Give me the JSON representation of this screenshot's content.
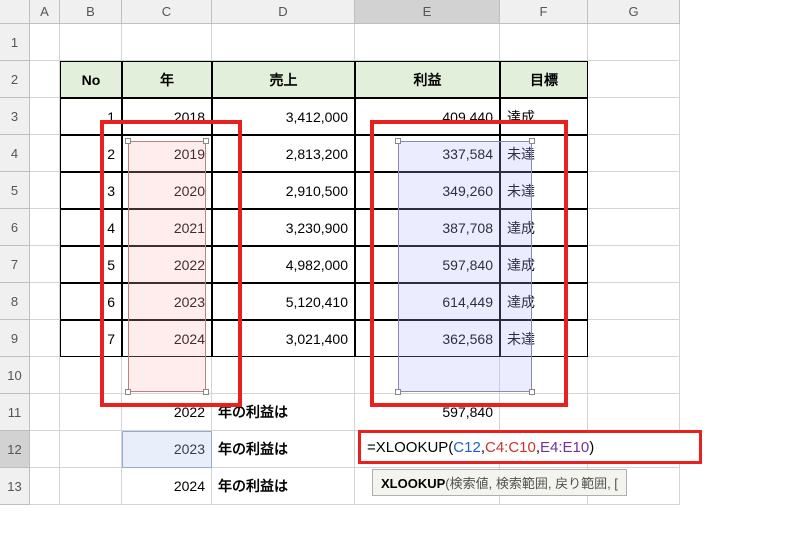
{
  "columns": [
    "A",
    "B",
    "C",
    "D",
    "E",
    "F",
    "G"
  ],
  "headers": {
    "no": "No",
    "year": "年",
    "sales": "売上",
    "profit": "利益",
    "target": "目標"
  },
  "rows": [
    {
      "no": 1,
      "year": 2018,
      "sales": "3,412,000",
      "profit": "409,440",
      "target": "達成"
    },
    {
      "no": 2,
      "year": 2019,
      "sales": "2,813,200",
      "profit": "337,584",
      "target": "未達"
    },
    {
      "no": 3,
      "year": 2020,
      "sales": "2,910,500",
      "profit": "349,260",
      "target": "未達"
    },
    {
      "no": 4,
      "year": 2021,
      "sales": "3,230,900",
      "profit": "387,708",
      "target": "達成"
    },
    {
      "no": 5,
      "year": 2022,
      "sales": "4,982,000",
      "profit": "597,840",
      "target": "達成"
    },
    {
      "no": 6,
      "year": 2023,
      "sales": "5,120,410",
      "profit": "614,449",
      "target": "達成"
    },
    {
      "no": 7,
      "year": 2024,
      "sales": "3,021,400",
      "profit": "362,568",
      "target": "未達"
    }
  ],
  "lookup_rows": [
    {
      "year": 2022,
      "label": "年の利益は",
      "result": "597,840"
    },
    {
      "year": 2023,
      "label": "年の利益は",
      "result": ""
    },
    {
      "year": 2024,
      "label": "年の利益は",
      "result": ""
    }
  ],
  "formula": {
    "prefix": "=XLOOKUP(",
    "arg1": "C12",
    "arg2": "C4:C10",
    "arg3": "E4:E10",
    "suffix": ")"
  },
  "tooltip": {
    "fn": "XLOOKUP",
    "args": "(検索値, 検索範囲, 戻り範囲, ["
  },
  "row_labels": [
    "1",
    "2",
    "3",
    "4",
    "5",
    "6",
    "7",
    "8",
    "9",
    "10",
    "11",
    "12",
    "13"
  ],
  "active_row": "12",
  "active_col": "E"
}
